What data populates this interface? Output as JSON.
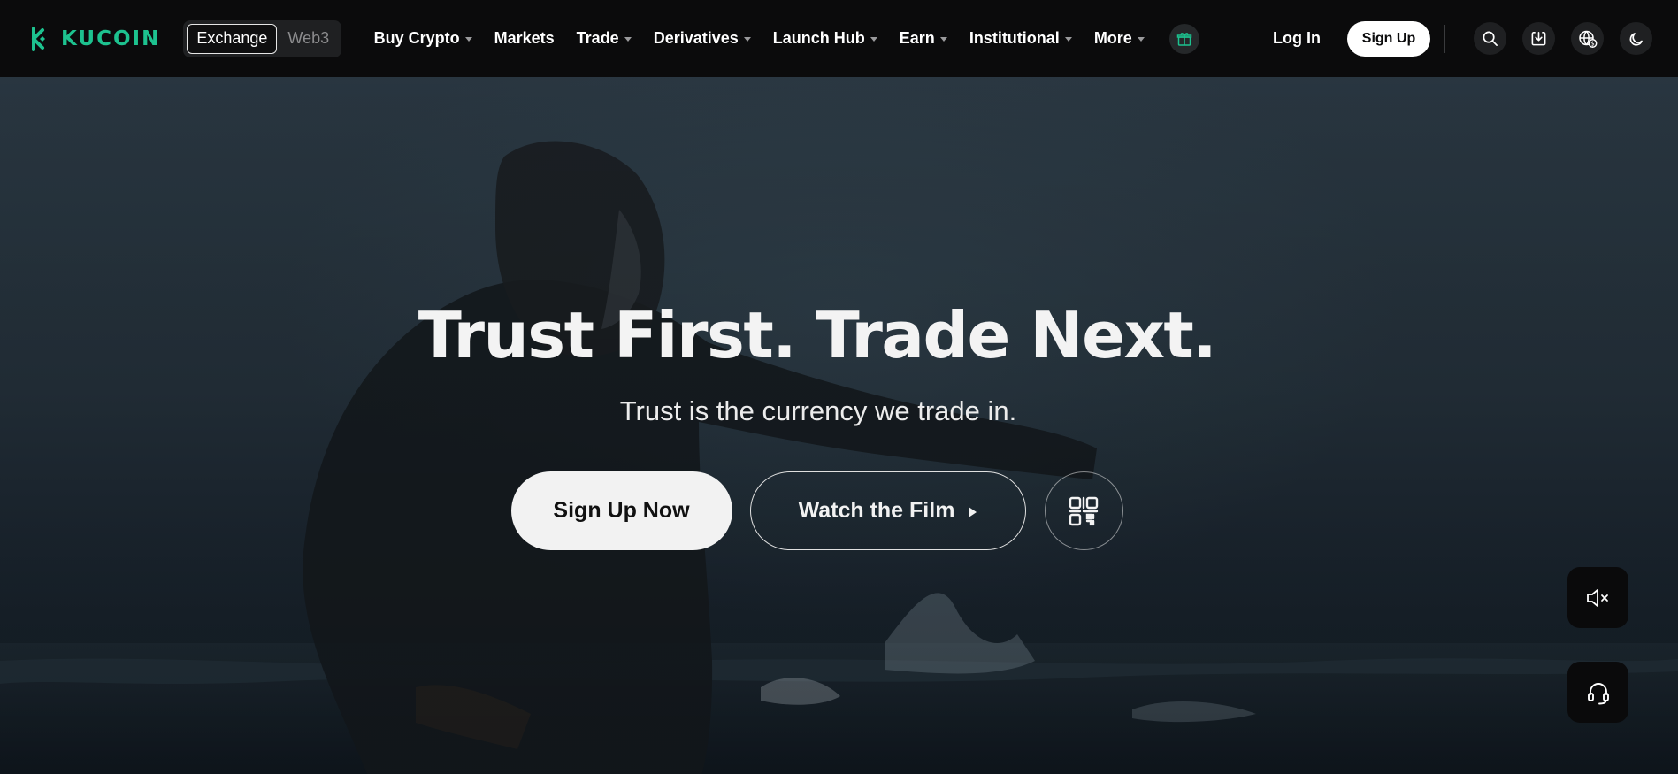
{
  "brand": {
    "name": "KUCOIN",
    "color": "#1dc28f"
  },
  "mode_switch": {
    "items": [
      {
        "label": "Exchange",
        "active": true
      },
      {
        "label": "Web3",
        "active": false
      }
    ]
  },
  "nav": {
    "items": [
      {
        "label": "Buy Crypto",
        "dropdown": true
      },
      {
        "label": "Markets",
        "dropdown": false
      },
      {
        "label": "Trade",
        "dropdown": true
      },
      {
        "label": "Derivatives",
        "dropdown": true
      },
      {
        "label": "Launch Hub",
        "dropdown": true
      },
      {
        "label": "Earn",
        "dropdown": true
      },
      {
        "label": "Institutional",
        "dropdown": true
      },
      {
        "label": "More",
        "dropdown": true
      }
    ]
  },
  "auth": {
    "login_label": "Log In",
    "signup_label": "Sign Up"
  },
  "icons": {
    "gift": "gift-icon",
    "search": "search-icon",
    "download": "download-icon",
    "language": "globe-currency-icon",
    "theme": "moon-icon",
    "qr": "qr-code-icon",
    "mute": "speaker-muted-icon",
    "support": "headset-icon"
  },
  "hero": {
    "title": "Trust First. Trade Next.",
    "subtitle": "Trust is the currency we trade in.",
    "primary_cta": "Sign Up Now",
    "secondary_cta": "Watch the Film"
  }
}
